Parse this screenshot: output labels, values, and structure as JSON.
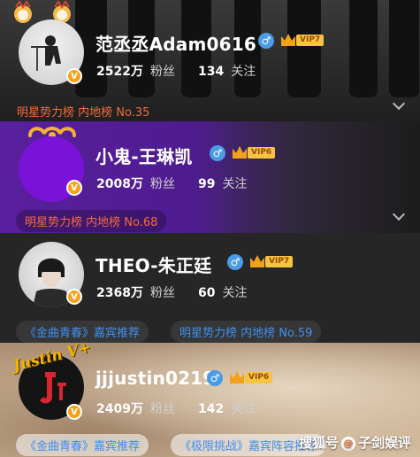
{
  "cards": [
    {
      "name": "范丞丞Adam0616",
      "gender_icon": "male-icon",
      "vip_level": "VIP7",
      "fans_count": "2522万",
      "fans_label": "粉丝",
      "following_count": "134",
      "following_label": "关注",
      "tags": [
        "明星势力榜 内地榜 No.35"
      ],
      "verified_badge": "V"
    },
    {
      "name": "小鬼-王琳凯",
      "gender_icon": "male-icon",
      "vip_level": "VIP6",
      "fans_count": "2008万",
      "fans_label": "粉丝",
      "following_count": "99",
      "following_label": "关注",
      "tags": [
        "明星势力榜 内地榜 No.68"
      ],
      "verified_badge": "V"
    },
    {
      "name": "THEO-朱正廷",
      "gender_icon": "male-icon",
      "vip_level": "VIP7",
      "fans_count": "2368万",
      "fans_label": "粉丝",
      "following_count": "60",
      "following_label": "关注",
      "tags": [
        "《金曲青春》嘉宾推荐",
        "明星势力榜 内地榜 No.59"
      ],
      "verified_badge": "V"
    },
    {
      "name": "jjjustin0219",
      "gender_icon": "male-icon",
      "vip_level": "VIP6",
      "fans_count": "2409万",
      "fans_label": "粉丝",
      "following_count": "142",
      "following_label": "关注",
      "tags": [
        "《金曲青春》嘉宾推荐",
        "《极限挑战》嘉宾阵容推荐"
      ],
      "verified_badge": "V",
      "avatar_frame_text": "Justin V+"
    }
  ],
  "watermark": {
    "text_left": "搜狐号",
    "text_right": "子剑娱评",
    "separator": "@"
  },
  "colors": {
    "rank_tag": "#f46b3b",
    "recommend_tag": "#3f8ff0",
    "vip_gold": "#f6c343",
    "gender_blue": "#4a9be8",
    "verified_orange": "#f7a317"
  }
}
